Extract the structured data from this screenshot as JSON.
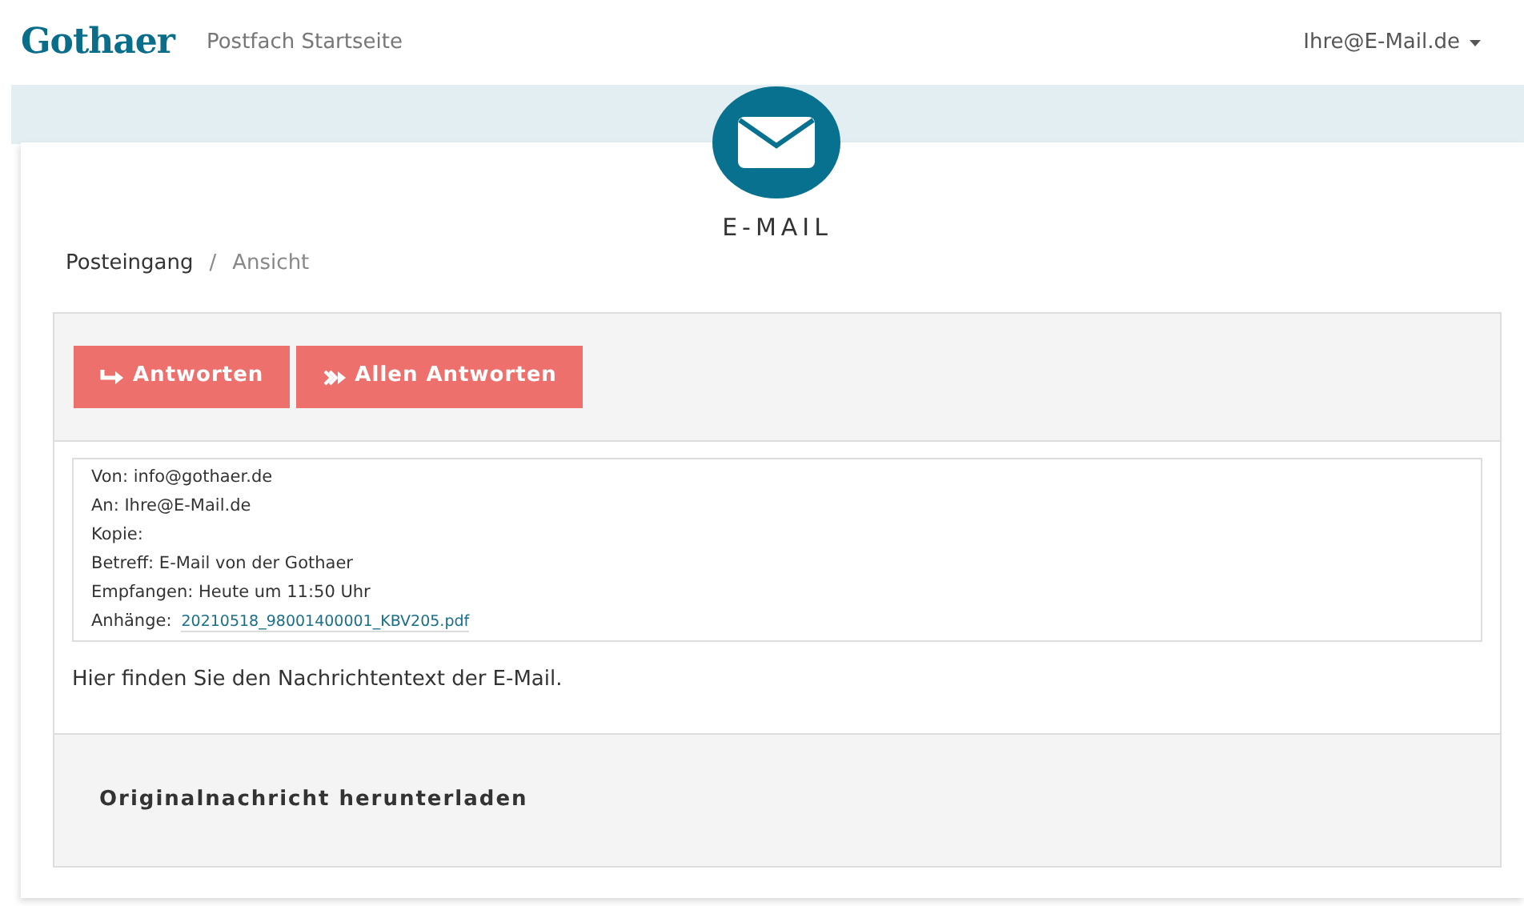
{
  "navbar": {
    "logo": "Gothaer",
    "link": "Postfach Startseite",
    "user": "Ihre@E-Mail.de"
  },
  "page": {
    "title": "E-MAIL"
  },
  "breadcrumb_separator": "/",
  "breadcrumb": [
    {
      "label": "Posteingang",
      "selected": false
    },
    {
      "label": "Ansicht",
      "selected": true
    }
  ],
  "actions": [
    {
      "label": "Antworten",
      "kind": "reply"
    },
    {
      "label": "Allen Antworten",
      "kind": "reply-all"
    }
  ],
  "header_fields": [
    {
      "label": "Von:",
      "value": "info@gothaer.de",
      "kind": "text"
    },
    {
      "label": "An:",
      "value": "Ihre@E-Mail.de",
      "kind": "text"
    },
    {
      "label": "Kopie:",
      "kind": "text"
    },
    {
      "label": "Betreff:",
      "value": "E-Mail von der Gothaer",
      "kind": "text"
    },
    {
      "label": "Empfangen:",
      "value": "Heute um 11:50 Uhr",
      "kind": "text"
    },
    {
      "label": "Anhänge:",
      "value": "20210518_98001400001_KBV205.pdf",
      "kind": "attachment"
    }
  ],
  "body": "Hier finden Sie den Nachrichtentext der E-Mail.",
  "footer_link": "Originalnachricht herunterladen"
}
